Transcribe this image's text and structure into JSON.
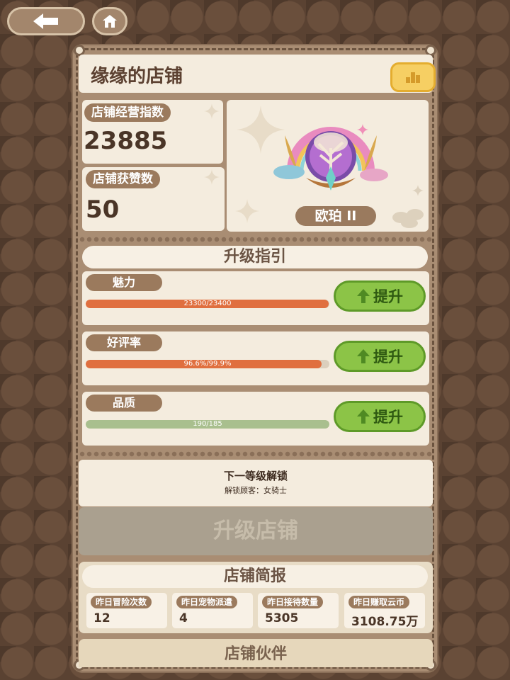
{
  "nav": {
    "back_icon": "arrow-left-icon",
    "home_icon": "home-icon"
  },
  "header": {
    "title": "缘缘的店铺",
    "rank_icon": "ranking-icon"
  },
  "stats": {
    "index_label": "店铺经营指数",
    "index_value": "23885",
    "likes_label": "店铺获赞数",
    "likes_value": "50"
  },
  "rank": {
    "name": "欧珀 II",
    "badge_icon": "tree-badge-icon"
  },
  "guide": {
    "title": "升级指引",
    "items": [
      {
        "label": "魅力",
        "progress_text": "23300/23400",
        "progress": 0.996,
        "bar_color": "#e06f3f",
        "button": "提升"
      },
      {
        "label": "好评率",
        "progress_text": "96.6%/99.9%",
        "progress": 0.967,
        "bar_color": "#e06f3f",
        "button": "提升"
      },
      {
        "label": "品质",
        "progress_text": "190/185",
        "progress": 1.0,
        "bar_color": "#a9bf8e",
        "button": "提升"
      }
    ]
  },
  "unlock": {
    "title": "下一等级解锁",
    "detail": "解锁顾客：女骑士"
  },
  "upgrade_button": "升级店铺",
  "report": {
    "title": "店铺简报",
    "items": [
      {
        "label": "昨日冒险次数",
        "value": "12"
      },
      {
        "label": "昨日宠物派遣",
        "value": "4"
      },
      {
        "label": "昨日接待数量",
        "value": "5305"
      },
      {
        "label": "昨日赚取云币",
        "value": "3108.75万"
      }
    ]
  },
  "partners": {
    "title": "店铺伙伴"
  }
}
